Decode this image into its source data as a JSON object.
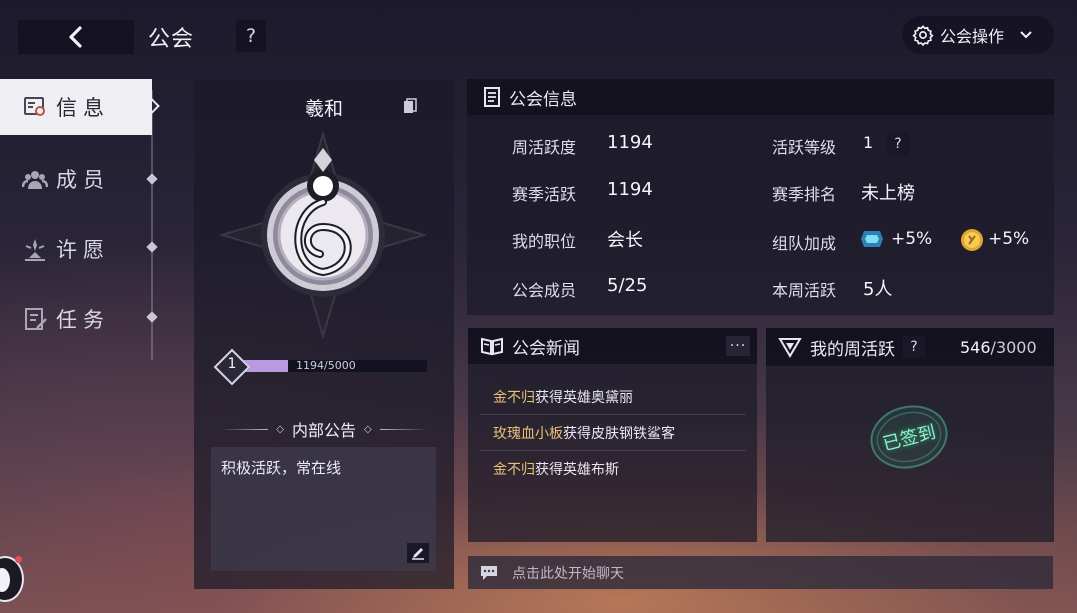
{
  "header": {
    "title": "公会",
    "help": "?",
    "ops_label": "公会操作"
  },
  "sidebar": {
    "items": [
      {
        "label": "信息",
        "icon": "info-card-icon",
        "active": true
      },
      {
        "label": "成员",
        "icon": "members-icon",
        "active": false
      },
      {
        "label": "许愿",
        "icon": "wish-icon",
        "active": false
      },
      {
        "label": "任务",
        "icon": "tasks-icon",
        "active": false
      }
    ]
  },
  "guild": {
    "name": "羲和",
    "level": "1",
    "exp_text": "1194/5000",
    "exp_fraction": 0.2388,
    "notice_title": "内部公告",
    "notice_text": "积极活跃，常在线"
  },
  "info": {
    "title": "公会信息",
    "rows": [
      {
        "label": "周活跃度",
        "value": "1194"
      },
      {
        "label": "赛季活跃",
        "value": "1194"
      },
      {
        "label": "我的职位",
        "value": "会长"
      },
      {
        "label": "公会成员",
        "value": "5/25"
      }
    ],
    "right_rows": [
      {
        "label": "活跃等级",
        "value": "1",
        "help": "?"
      },
      {
        "label": "赛季排名",
        "value": "未上榜"
      },
      {
        "label": "组队加成",
        "bonus1": "+5%",
        "bonus2": "+5%"
      },
      {
        "label": "本周活跃",
        "value": "5人"
      }
    ]
  },
  "news": {
    "title": "公会新闻",
    "more": "···",
    "items": [
      {
        "who": "金不归",
        "text": "获得英雄奥黛丽"
      },
      {
        "who": "玫瑰血小板",
        "text": "获得皮肤钢铁鲨客"
      },
      {
        "who": "金不归",
        "text": "获得英雄布斯"
      }
    ]
  },
  "weekly": {
    "title": "我的周活跃",
    "help": "?",
    "score": "546",
    "max": "/3000",
    "stamp": "已签到"
  },
  "chat": {
    "placeholder": "点击此处开始聊天"
  },
  "colors": {
    "accent": "#b89ae0",
    "gold": "#e7c17a",
    "stamp": "#4fcf9a",
    "active_tab": "#efeef3"
  }
}
